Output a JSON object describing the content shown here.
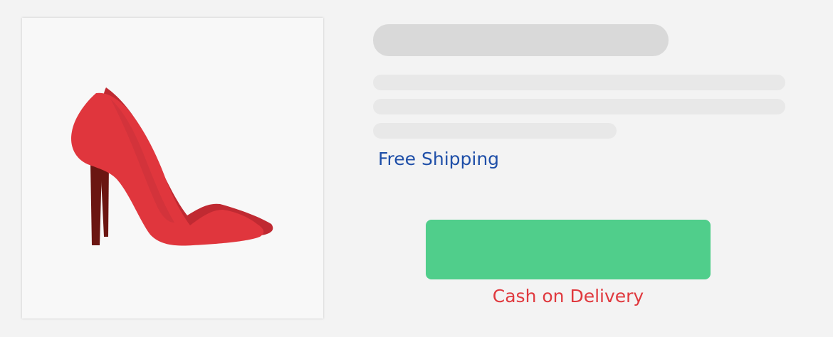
{
  "product": {
    "image_name": "red-high-heel-shoe",
    "colors": {
      "shoe_main": "#e0363d",
      "shoe_shade": "#c02a32",
      "shoe_inner": "#8a1a1e",
      "heel": "#6b1612"
    }
  },
  "details": {
    "shipping_text": "Free Shipping",
    "payment_text": "Cash on Delivery"
  },
  "colors": {
    "background": "#f3f3f3",
    "card": "#f8f8f8",
    "skeleton_dark": "#d9d9d9",
    "skeleton_light": "#e8e8e8",
    "shipping_text": "#1f4fa8",
    "buy_button": "#50ce8b",
    "payment_text": "#e0393e"
  }
}
